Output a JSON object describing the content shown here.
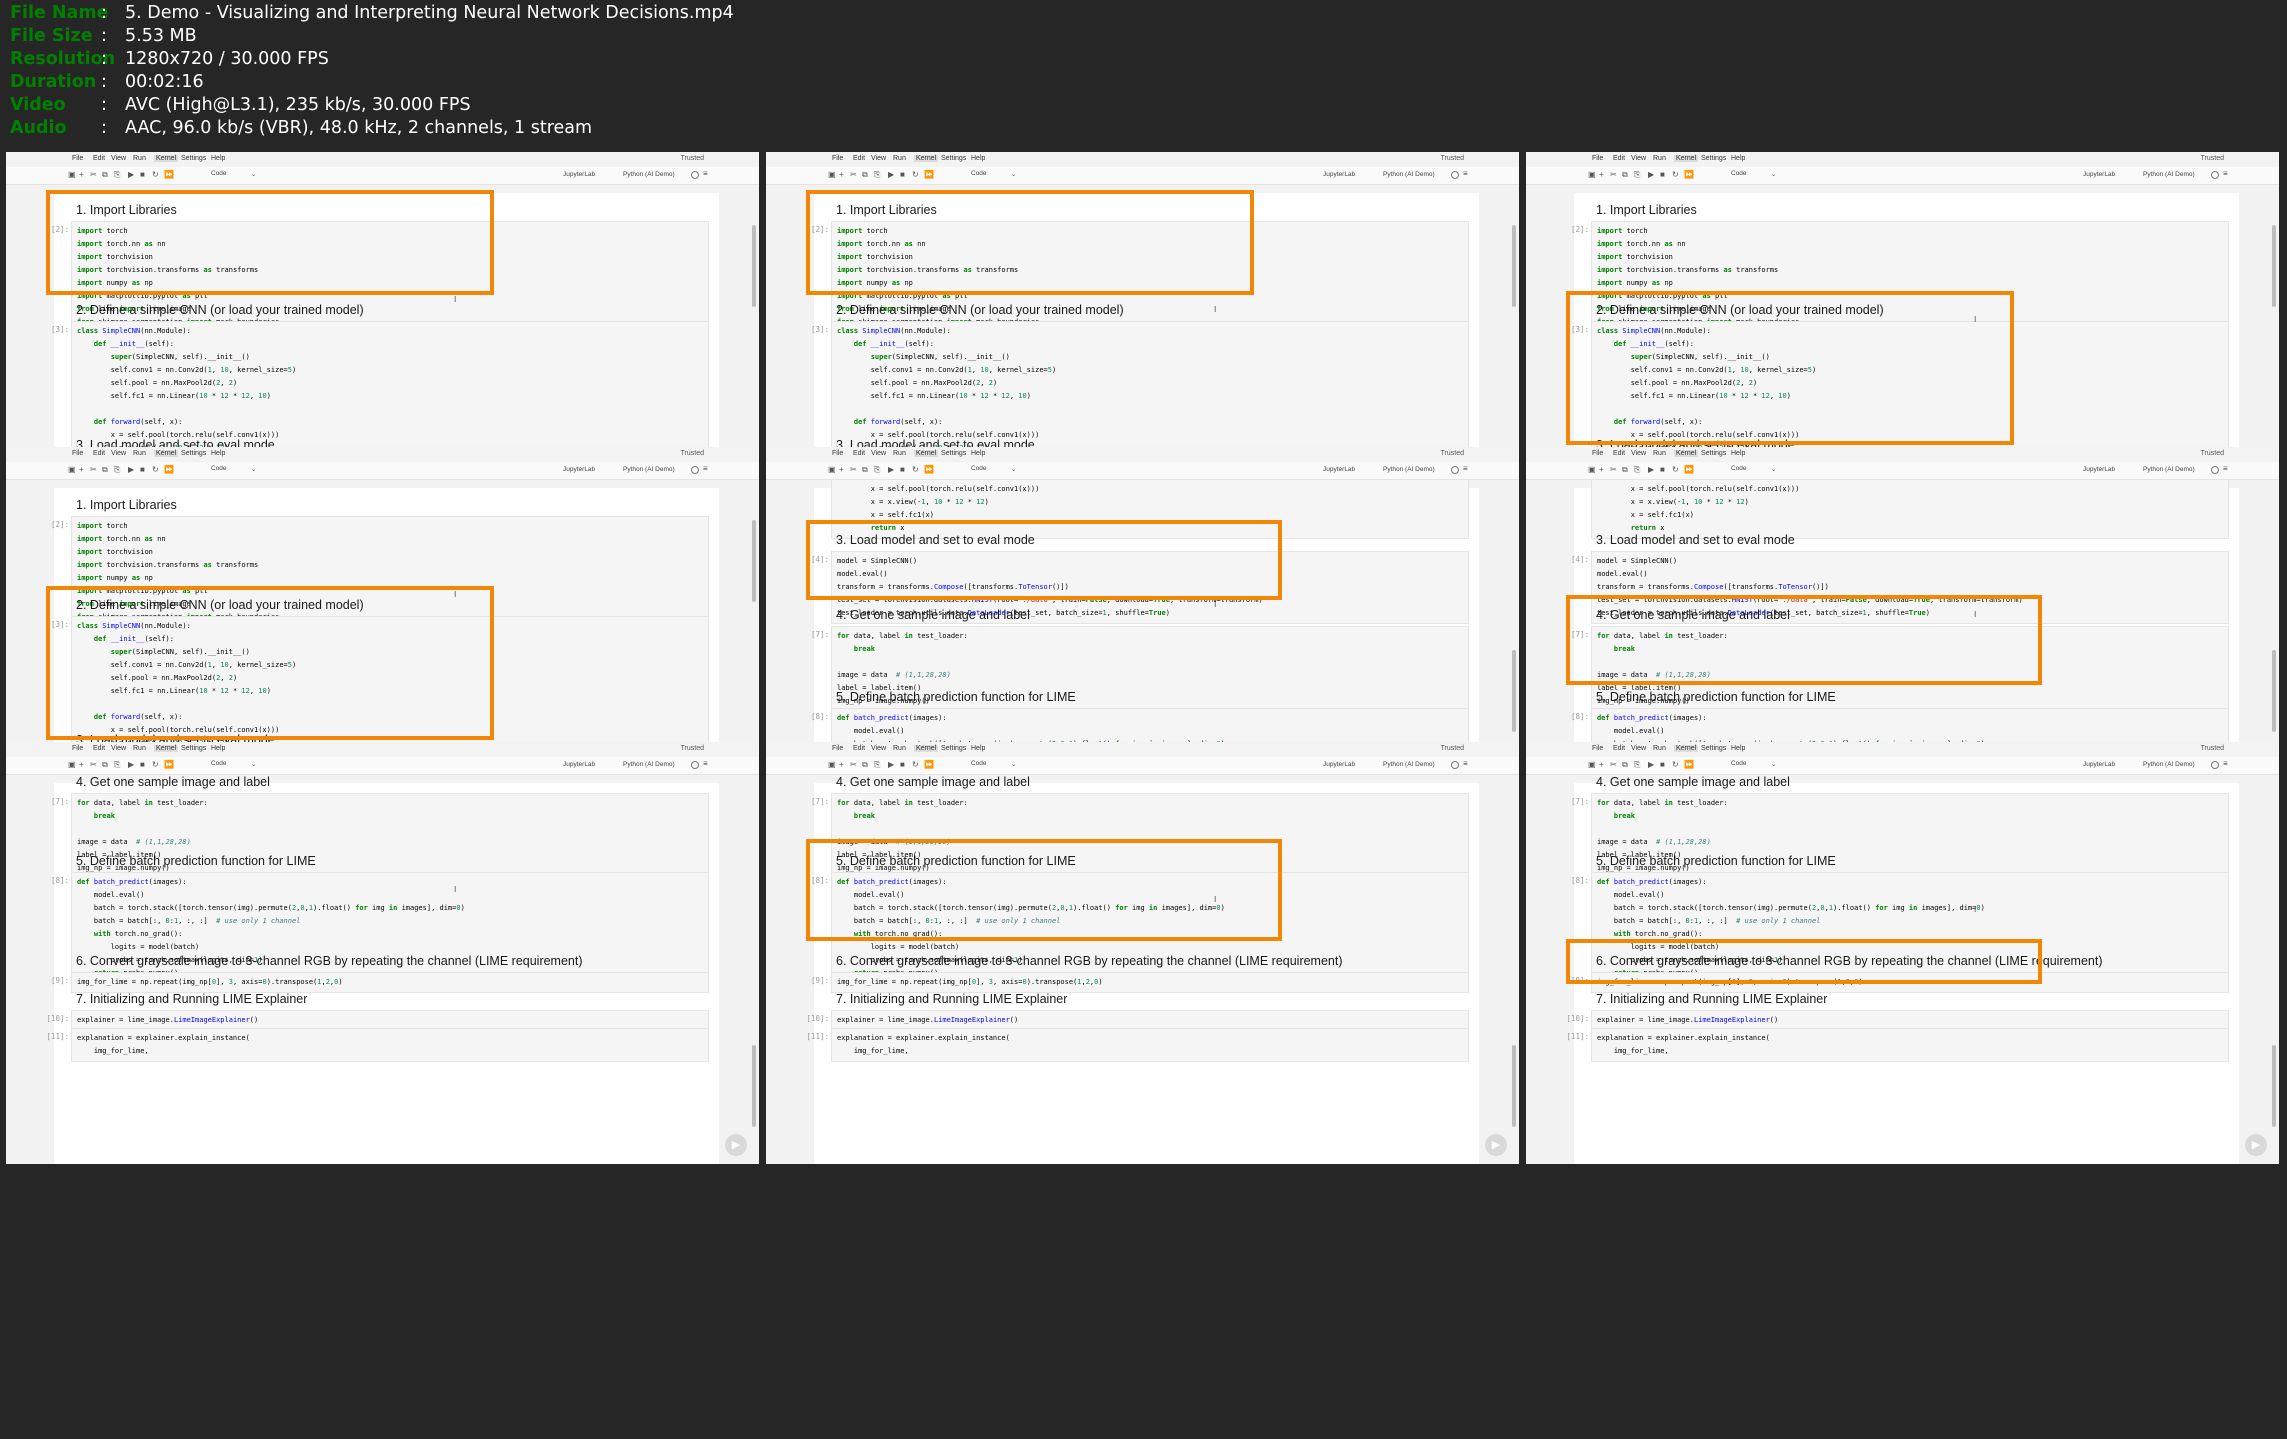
{
  "file_info": {
    "rows": [
      {
        "label": "File Name",
        "value": "5. Demo - Visualizing and Interpreting Neural  Network Decisions.mp4"
      },
      {
        "label": "File Size",
        "value": "5.53 MB"
      },
      {
        "label": "Resolution",
        "value": "1280x720 / 30.000 FPS"
      },
      {
        "label": "Duration",
        "value": "00:02:16"
      },
      {
        "label": "Video",
        "value": "AVC (High@L3.1), 235 kb/s, 30.000 FPS"
      },
      {
        "label": "Audio",
        "value": "AAC, 96.0 kb/s (VBR), 48.0 kHz, 2 channels, 1 stream"
      }
    ],
    "separator": ":"
  },
  "menu": {
    "items": [
      "File",
      "Edit",
      "View",
      "Run",
      "Kernel",
      "Settings",
      "Help"
    ],
    "active": "Kernel",
    "trusted": "Trusted"
  },
  "toolbar": {
    "cell_type": "Code",
    "jupyterlab": "JupyterLab",
    "kernel": "Python (AI Demo)"
  },
  "notebook": {
    "headings": [
      "1. Import Libraries",
      "2. Define a simple CNN (or load your trained model)",
      "3. Load model and set to eval mode",
      "4. Get one sample image and label",
      "5. Define batch prediction function for LIME",
      "6. Convert grayscale image to 3-channel RGB by repeating the channel (LIME requirement)",
      "7. Initializing and Running LIME Explainer"
    ],
    "prompts": [
      "[2]:",
      "[3]:",
      "[4]:",
      "[7]:",
      "[8]:",
      "[9]:",
      "[10]:",
      "[11]:"
    ]
  },
  "accent_color": "#f28705",
  "frames": [
    {
      "label": "frame-1",
      "highlight": "1. Import Libraries"
    },
    {
      "label": "frame-2",
      "highlight": "1. Import Libraries"
    },
    {
      "label": "frame-3",
      "highlight": "2. Define a simple CNN (or load your trained model)"
    },
    {
      "label": "frame-4",
      "highlight": "2. Define a simple CNN (or load your trained model)"
    },
    {
      "label": "frame-5",
      "highlight": "3. Load model and set to eval mode"
    },
    {
      "label": "frame-6",
      "highlight": "4. Get one sample image and label"
    },
    {
      "label": "frame-7",
      "highlight": "none"
    },
    {
      "label": "frame-8",
      "highlight": "5. Define batch prediction function for LIME"
    },
    {
      "label": "frame-9",
      "highlight": "6. Convert grayscale image to 3-channel RGB by repeating the channel (LIME requirement)"
    }
  ]
}
